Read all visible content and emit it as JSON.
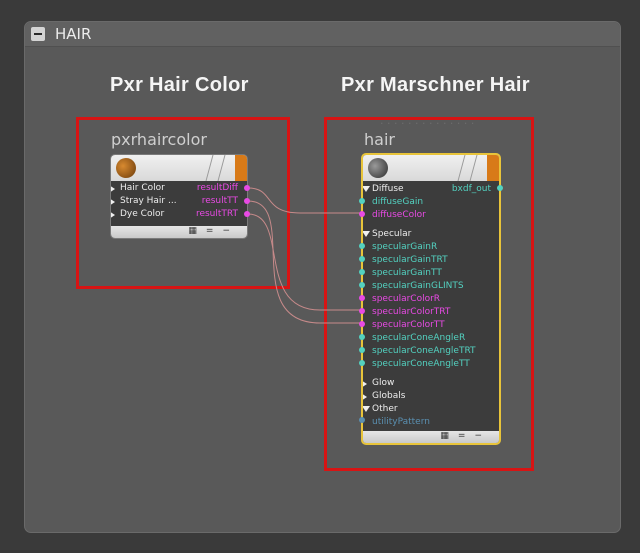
{
  "panel": {
    "title": "HAIR"
  },
  "labels": {
    "left": "Pxr Hair Color",
    "right": "Pxr Marschner Hair"
  },
  "colors": {
    "highlight_box": "#d81414",
    "magenta_port": "#e84ae4",
    "cyan_port": "#53d1c0",
    "selected_border": "#e8c43a"
  },
  "nodes": {
    "haircolor": {
      "name": "pxrhaircolor",
      "inputs": [
        "Hair Color",
        "Stray Hair ...",
        "Dye Color"
      ],
      "outputs": [
        "resultDiff",
        "resultTT",
        "resultTRT"
      ],
      "footer_icons": [
        "grid-icon",
        "equals-icon",
        "minus-icon"
      ]
    },
    "marschner": {
      "name": "hair",
      "output": "bxdf_out",
      "groups": {
        "diffuse": {
          "label": "Diffuse",
          "params": [
            "diffuseGain",
            "diffuseColor"
          ]
        },
        "specular": {
          "label": "Specular",
          "params": [
            "specularGainR",
            "specularGainTRT",
            "specularGainTT",
            "specularGainGLINTS",
            "specularColorR",
            "specularColorTRT",
            "specularColorTT",
            "specularConeAngleR",
            "specularConeAngleTRT",
            "specularConeAngleTT"
          ]
        },
        "collapsed": [
          "Glow",
          "Globals",
          "Other"
        ]
      },
      "extra_param": "utilityPattern"
    }
  }
}
